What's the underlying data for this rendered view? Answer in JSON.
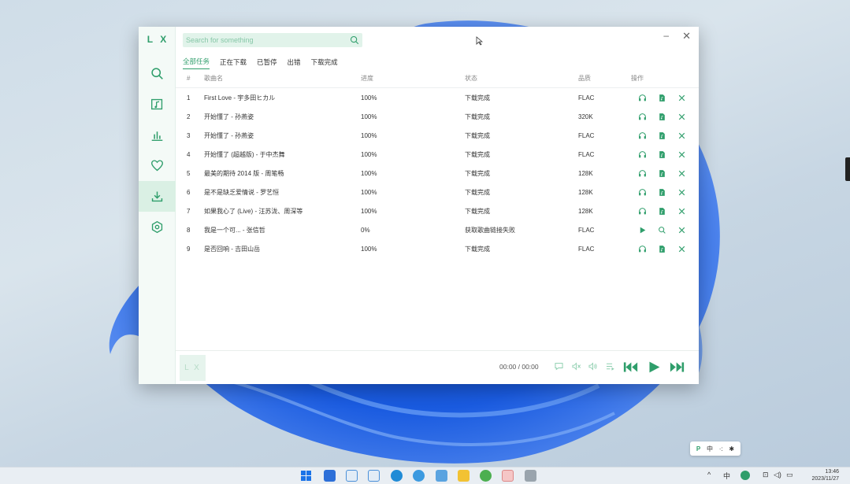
{
  "app": {
    "logo": "L X",
    "search_placeholder": "Search for something",
    "win_min": "–",
    "win_close": "✕"
  },
  "sidebar": {
    "items": [
      {
        "icon": "search-icon"
      },
      {
        "icon": "music-list-icon"
      },
      {
        "icon": "leaderboard-icon"
      },
      {
        "icon": "heart-icon"
      },
      {
        "icon": "download-icon",
        "active": true
      },
      {
        "icon": "settings-icon"
      }
    ]
  },
  "tabs": [
    "全部任务",
    "正在下载",
    "已暂停",
    "出错",
    "下载完成"
  ],
  "table": {
    "headers": {
      "num": "#",
      "name": "歌曲名",
      "progress": "进度",
      "status": "状态",
      "quality": "品质",
      "ops": "操作"
    },
    "rows": [
      {
        "num": "1",
        "name": "First Love - 宇多田ヒカル",
        "progress": "100%",
        "status": "下载完成",
        "quality": "FLAC",
        "state": "done"
      },
      {
        "num": "2",
        "name": "开始懂了 - 孙燕姿",
        "progress": "100%",
        "status": "下载完成",
        "quality": "320K",
        "state": "done"
      },
      {
        "num": "3",
        "name": "开始懂了 - 孙燕姿",
        "progress": "100%",
        "status": "下载完成",
        "quality": "FLAC",
        "state": "done"
      },
      {
        "num": "4",
        "name": "开始懂了 (超越版) - 于中杰舞",
        "progress": "100%",
        "status": "下载完成",
        "quality": "FLAC",
        "state": "done"
      },
      {
        "num": "5",
        "name": "最美的期待 2014 版 - 周笔畅",
        "progress": "100%",
        "status": "下载完成",
        "quality": "128K",
        "state": "done"
      },
      {
        "num": "6",
        "name": "是不是缺乏爱情说 - 罗艺恒",
        "progress": "100%",
        "status": "下载完成",
        "quality": "128K",
        "state": "done"
      },
      {
        "num": "7",
        "name": "如果我心了 (Live) - 汪苏泷、周深等",
        "progress": "100%",
        "status": "下载完成",
        "quality": "128K",
        "state": "done"
      },
      {
        "num": "8",
        "name": "我是一个可... - 张信哲",
        "progress": "0%",
        "status": "获取歌曲链接失败",
        "quality": "FLAC",
        "state": "error"
      },
      {
        "num": "9",
        "name": "是否回响 - 吉田山岳",
        "progress": "100%",
        "status": "下载完成",
        "quality": "FLAC",
        "state": "done"
      }
    ]
  },
  "player": {
    "cover_text": "L X",
    "time": "00:00 / 00:00"
  },
  "taskbar": {
    "ime_lang": "中",
    "clock_time": "13:46",
    "clock_date": "2023/11/27"
  },
  "ime_bar": [
    "P",
    "中",
    "·:",
    "✱"
  ],
  "colors": {
    "accent": "#2f9e6b",
    "accent_light": "#e1f3ea",
    "sidebar_bg": "#f4faf7"
  }
}
